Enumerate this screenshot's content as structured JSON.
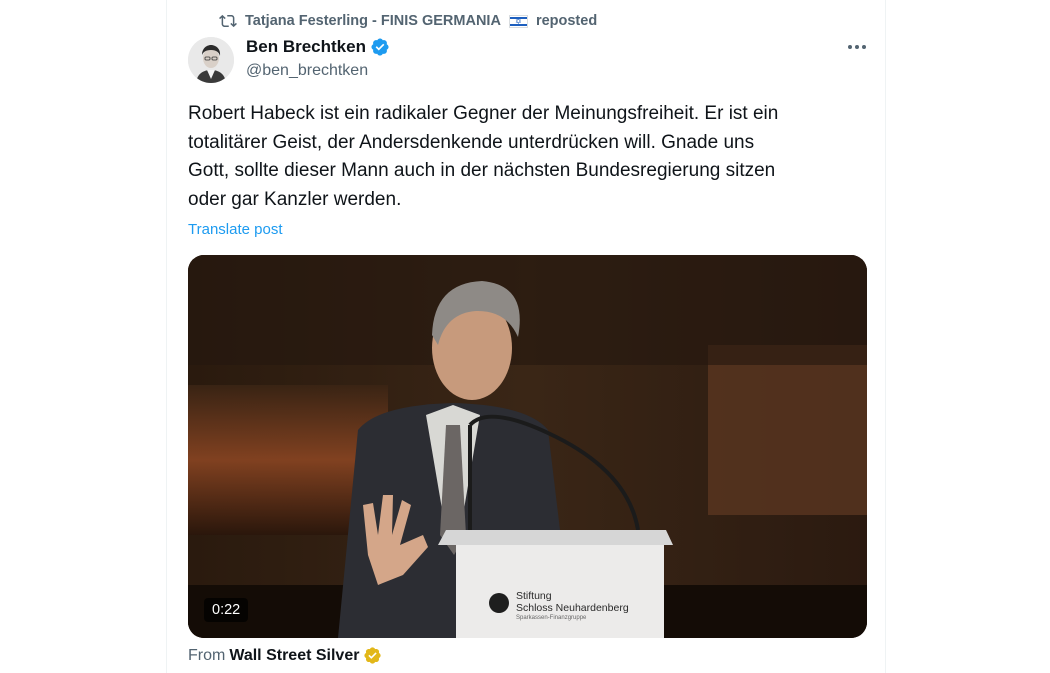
{
  "repost": {
    "reposter": "Tatjana Festerling - FINIS GERMANIA",
    "suffix": "reposted",
    "icon": "repost-icon",
    "flag": "israel-flag-icon"
  },
  "author": {
    "name": "Ben Brechtken",
    "handle": "@ben_brechtken",
    "verified_color": "#1d9bf0"
  },
  "post": {
    "text": "Robert Habeck ist ein radikaler Gegner der Meinungsfreiheit. Er ist ein\ntotalitärer Geist, der Andersdenkende unterdrücken will. Gnade uns\nGott, sollte dieser Mann auch in der nächsten Bundesregierung sitzen\noder gar Kanzler werden.",
    "translate_label": "Translate post"
  },
  "video": {
    "duration": "0:22",
    "podium_line1": "Stiftung",
    "podium_line2": "Schloss Neuhardenberg",
    "podium_line3": "Sparkassen-Finanzgruppe"
  },
  "source": {
    "prefix": "From",
    "name": "Wall Street Silver",
    "badge_color": "#e2b719"
  },
  "colors": {
    "text": "#0f1419",
    "secondary": "#536471",
    "link": "#1d9bf0"
  }
}
